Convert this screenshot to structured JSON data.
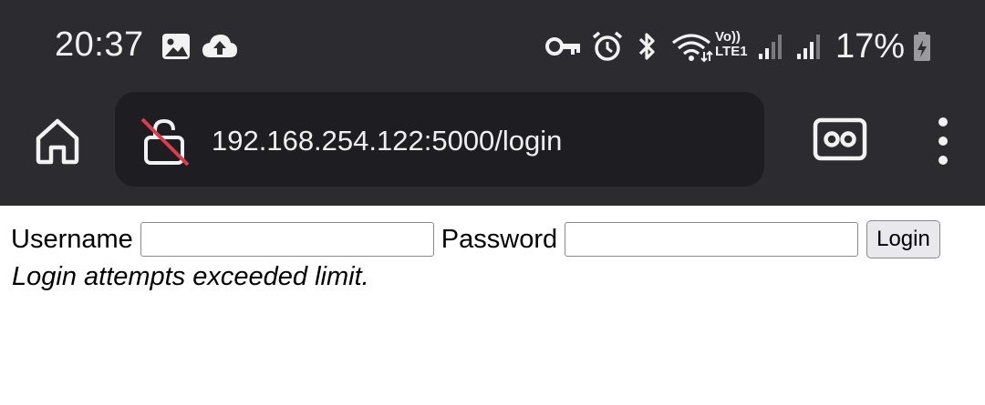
{
  "status_bar": {
    "time": "20:37",
    "battery_percent": "17%",
    "volte_line1": "Vo))",
    "volte_line2": "LTE1",
    "icons": [
      "gallery-icon",
      "cloud-upload-icon",
      "vpn-key-icon",
      "alarm-icon",
      "bluetooth-icon",
      "wifi-icon",
      "volte-icon",
      "signal-icon",
      "signal-icon",
      "battery-charging-icon"
    ]
  },
  "toolbar": {
    "url": "192.168.254.122:5000/login",
    "icons": [
      "home-icon",
      "insecure-lock-icon",
      "incognito-tabs-icon",
      "more-vert-icon"
    ]
  },
  "login_form": {
    "username_label": "Username",
    "password_label": "Password",
    "username_value": "",
    "password_value": "",
    "submit_label": "Login",
    "error_message": "Login attempts exceeded limit."
  },
  "colors": {
    "chrome_bg": "#2b2b30",
    "omnibox_bg": "#1e1e22",
    "insecure_red": "#e23a4a",
    "page_bg": "#ffffff"
  }
}
